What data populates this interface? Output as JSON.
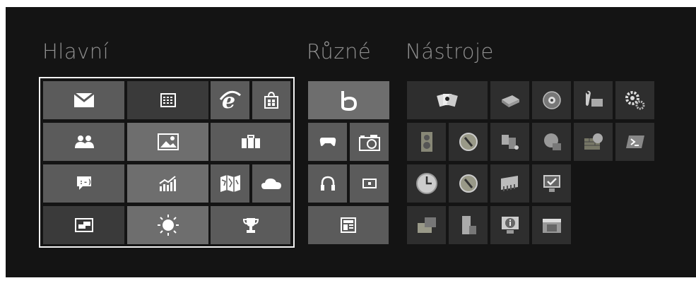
{
  "groups": {
    "main": "Hlavní",
    "misc": "Různé",
    "tools": "Nástroje"
  },
  "tiles": {
    "main": [
      {
        "name": "mail-tile",
        "icon": "mail-icon"
      },
      {
        "name": "calendar-tile",
        "icon": "calendar-icon"
      },
      {
        "name": "internet-explorer-tile",
        "icon": "internet-explorer-icon"
      },
      {
        "name": "store-tile",
        "icon": "store-icon"
      },
      {
        "name": "people-tile",
        "icon": "people-icon"
      },
      {
        "name": "photos-tile",
        "icon": "photos-icon"
      },
      {
        "name": "travel-tile",
        "icon": "briefcase-icon"
      },
      {
        "name": "messaging-tile",
        "icon": "chat-icon"
      },
      {
        "name": "finance-tile",
        "icon": "chart-icon"
      },
      {
        "name": "maps-tile",
        "icon": "map-icon"
      },
      {
        "name": "skydrive-tile",
        "icon": "cloud-icon"
      },
      {
        "name": "desktop-tile",
        "icon": "desktop-icon"
      },
      {
        "name": "weather-tile",
        "icon": "sun-icon"
      },
      {
        "name": "sports-tile",
        "icon": "trophy-icon"
      }
    ],
    "misc": [
      {
        "name": "bing-tile",
        "icon": "bing-icon"
      },
      {
        "name": "games-tile",
        "icon": "gamepad-icon"
      },
      {
        "name": "camera-tile",
        "icon": "camera-icon"
      },
      {
        "name": "music-tile",
        "icon": "headphones-icon"
      },
      {
        "name": "video-tile",
        "icon": "video-icon"
      },
      {
        "name": "news-tile",
        "icon": "news-icon"
      }
    ],
    "tools": [
      {
        "name": "solitaire-tile",
        "icon": "cards-icon"
      },
      {
        "name": "scanner-tile",
        "icon": "scanner-icon"
      },
      {
        "name": "disk-tile",
        "icon": "disk-icon"
      },
      {
        "name": "tools-tile",
        "icon": "wrench-icon"
      },
      {
        "name": "settings-tile",
        "icon": "gears-icon"
      },
      {
        "name": "speaker-tile",
        "icon": "speaker-icon"
      },
      {
        "name": "compass-tile",
        "icon": "compass-icon"
      },
      {
        "name": "components-tile",
        "icon": "components-icon"
      },
      {
        "name": "network-tile",
        "icon": "network-globe-icon"
      },
      {
        "name": "firewall-tile",
        "icon": "firewall-icon"
      },
      {
        "name": "powershell-tile",
        "icon": "powershell-icon"
      },
      {
        "name": "clock-tile",
        "icon": "clock-icon"
      },
      {
        "name": "compass2-tile",
        "icon": "compass-icon"
      },
      {
        "name": "memory-tile",
        "icon": "memory-icon"
      },
      {
        "name": "monitor-tile",
        "icon": "monitor-check-icon"
      },
      {
        "name": "toolbox-tile",
        "icon": "toolbox-icon"
      },
      {
        "name": "server-tile",
        "icon": "server-lock-icon"
      },
      {
        "name": "info-tile",
        "icon": "info-monitor-icon"
      },
      {
        "name": "window-tile",
        "icon": "window-icon"
      }
    ]
  }
}
